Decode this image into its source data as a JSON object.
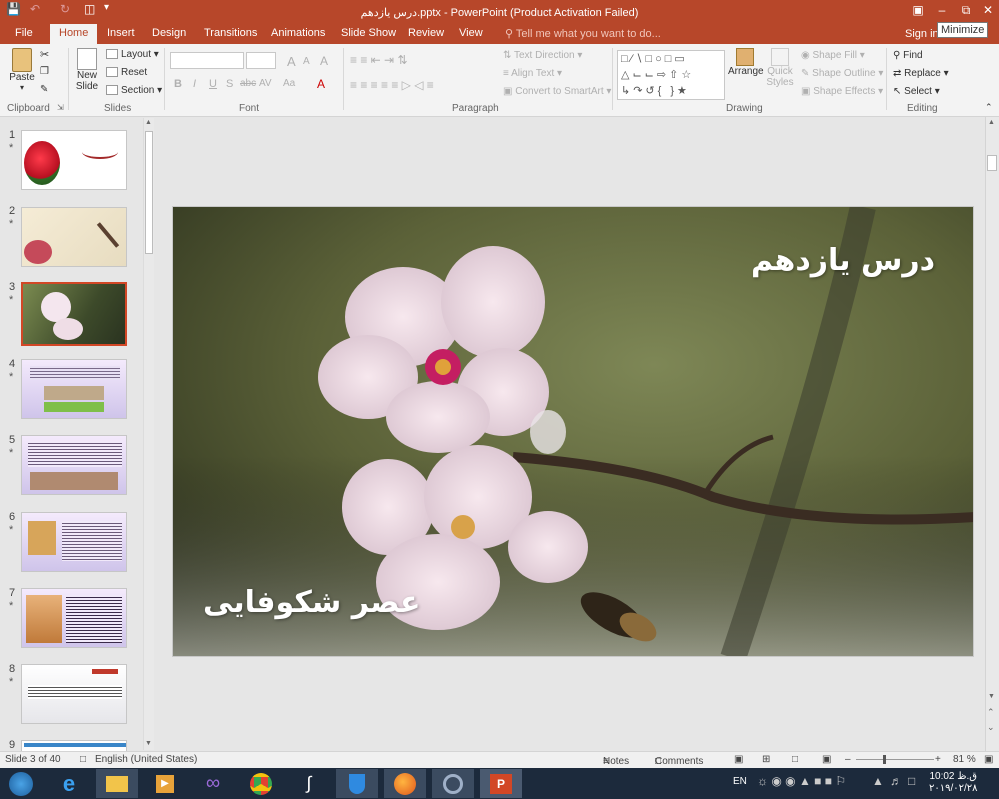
{
  "app": {
    "title": "درس یازدهم.pptx - PowerPoint (Product Activation Failed)"
  },
  "window": {
    "minimize_tooltip": "Minimize"
  },
  "tabs": [
    "File",
    "Home",
    "Insert",
    "Design",
    "Transitions",
    "Animations",
    "Slide Show",
    "Review",
    "View"
  ],
  "tell_me": "Tell me what you want to do...",
  "sign_in": "Sign in",
  "ribbon": {
    "clipboard": {
      "paste": "Paste",
      "label": "Clipboard"
    },
    "slides": {
      "new_slide_1": "New",
      "new_slide_2": "Slide",
      "layout": "Layout",
      "reset": "Reset",
      "section": "Section",
      "label": "Slides"
    },
    "font": {
      "label": "Font",
      "bold": "B",
      "italic": "I",
      "underline": "U",
      "strike": "S",
      "shadow": "abc",
      "spacing": "AV",
      "case": "Aa",
      "grow": "A",
      "shrink": "A",
      "clear": "A"
    },
    "paragraph": {
      "text_direction": "Text Direction",
      "align_text": "Align Text",
      "convert_smartart": "Convert to SmartArt",
      "label": "Paragraph"
    },
    "drawing": {
      "arrange": "Arrange",
      "quick_1": "Quick",
      "quick_2": "Styles",
      "shape_fill": "Shape Fill",
      "shape_outline": "Shape Outline",
      "shape_effects": "Shape Effects",
      "label": "Drawing"
    },
    "editing": {
      "find": "Find",
      "replace": "Replace",
      "select": "Select",
      "label": "Editing"
    }
  },
  "thumbnails": [
    {
      "num": "1",
      "star": "*",
      "style": "cover-rose"
    },
    {
      "num": "2",
      "star": "*",
      "style": "paper"
    },
    {
      "num": "3",
      "star": "*",
      "style": "blossom",
      "selected": true
    },
    {
      "num": "4",
      "star": "*",
      "style": "text-lavender"
    },
    {
      "num": "5",
      "star": "*",
      "style": "text-lavender"
    },
    {
      "num": "6",
      "star": "*",
      "style": "text-lavender"
    },
    {
      "num": "7",
      "star": "*",
      "style": "text-lavender"
    },
    {
      "num": "8",
      "star": "*",
      "style": "text-white"
    },
    {
      "num": "9",
      "star": "",
      "style": "text-white"
    }
  ],
  "slide": {
    "title": "درس یازدهم",
    "subtitle": "عصر شکوفایی"
  },
  "status": {
    "slide_info": "Slide 3 of 40",
    "language": "English (United States)",
    "notes": "Notes",
    "comments": "Comments",
    "zoom": "81 %"
  },
  "taskbar": {
    "lang": "EN",
    "time": "10:02 ق.ظ",
    "date": "۲۰۱۹/۰۲/۲۸"
  },
  "colors": {
    "accent": "#b7472a",
    "selected_thumb": "#d24726",
    "taskbar": "#1c2a3c"
  }
}
